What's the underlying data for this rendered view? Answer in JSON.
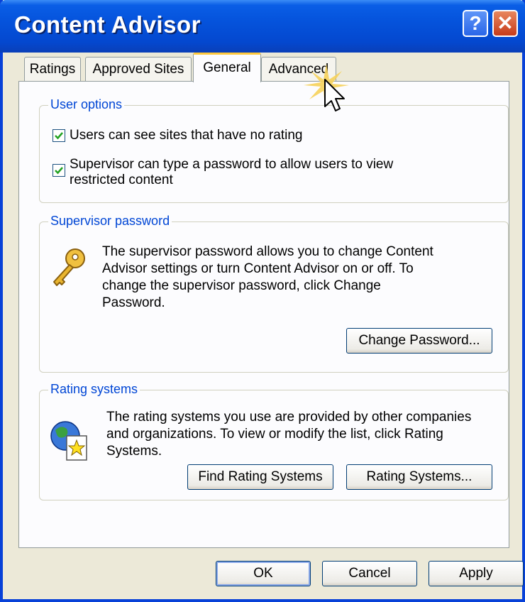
{
  "window": {
    "title": "Content Advisor"
  },
  "title_buttons": {
    "help": "?",
    "close": "✕"
  },
  "tabs": [
    {
      "label": "Ratings"
    },
    {
      "label": "Approved Sites"
    },
    {
      "label": "General"
    },
    {
      "label": "Advanced"
    }
  ],
  "active_tab": "General",
  "user_options": {
    "legend": "User options",
    "checkboxes": [
      {
        "label_line1": "Users can see sites that have no rating",
        "label_line2": "",
        "checked": true
      },
      {
        "label_line1": "Supervisor can type a password to allow users to view",
        "label_line2": "restricted content",
        "checked": true
      }
    ]
  },
  "supervisor_password": {
    "legend": "Supervisor password",
    "icon": "key-icon",
    "lines": [
      "The supervisor password allows you to change Content",
      "Advisor settings or turn Content Advisor on or off. To",
      "change the supervisor password, click Change",
      "Password."
    ],
    "change_button": "Change Password..."
  },
  "rating_systems": {
    "legend": "Rating systems",
    "icon": "globe-rating-document-icon",
    "lines": [
      "The rating systems you use are provided by other companies",
      "and organizations. To view or modify the list, click Rating",
      "Systems."
    ],
    "find_button": "Find Rating Systems",
    "rating_button": "Rating Systems..."
  },
  "footer": {
    "ok": "OK",
    "cancel": "Cancel",
    "apply": "Apply"
  },
  "colors": {
    "title_blue": "#0553dc",
    "legend_blue": "#0046d5",
    "check_green": "#21a121",
    "tab_highlight": "#ffc83c"
  }
}
